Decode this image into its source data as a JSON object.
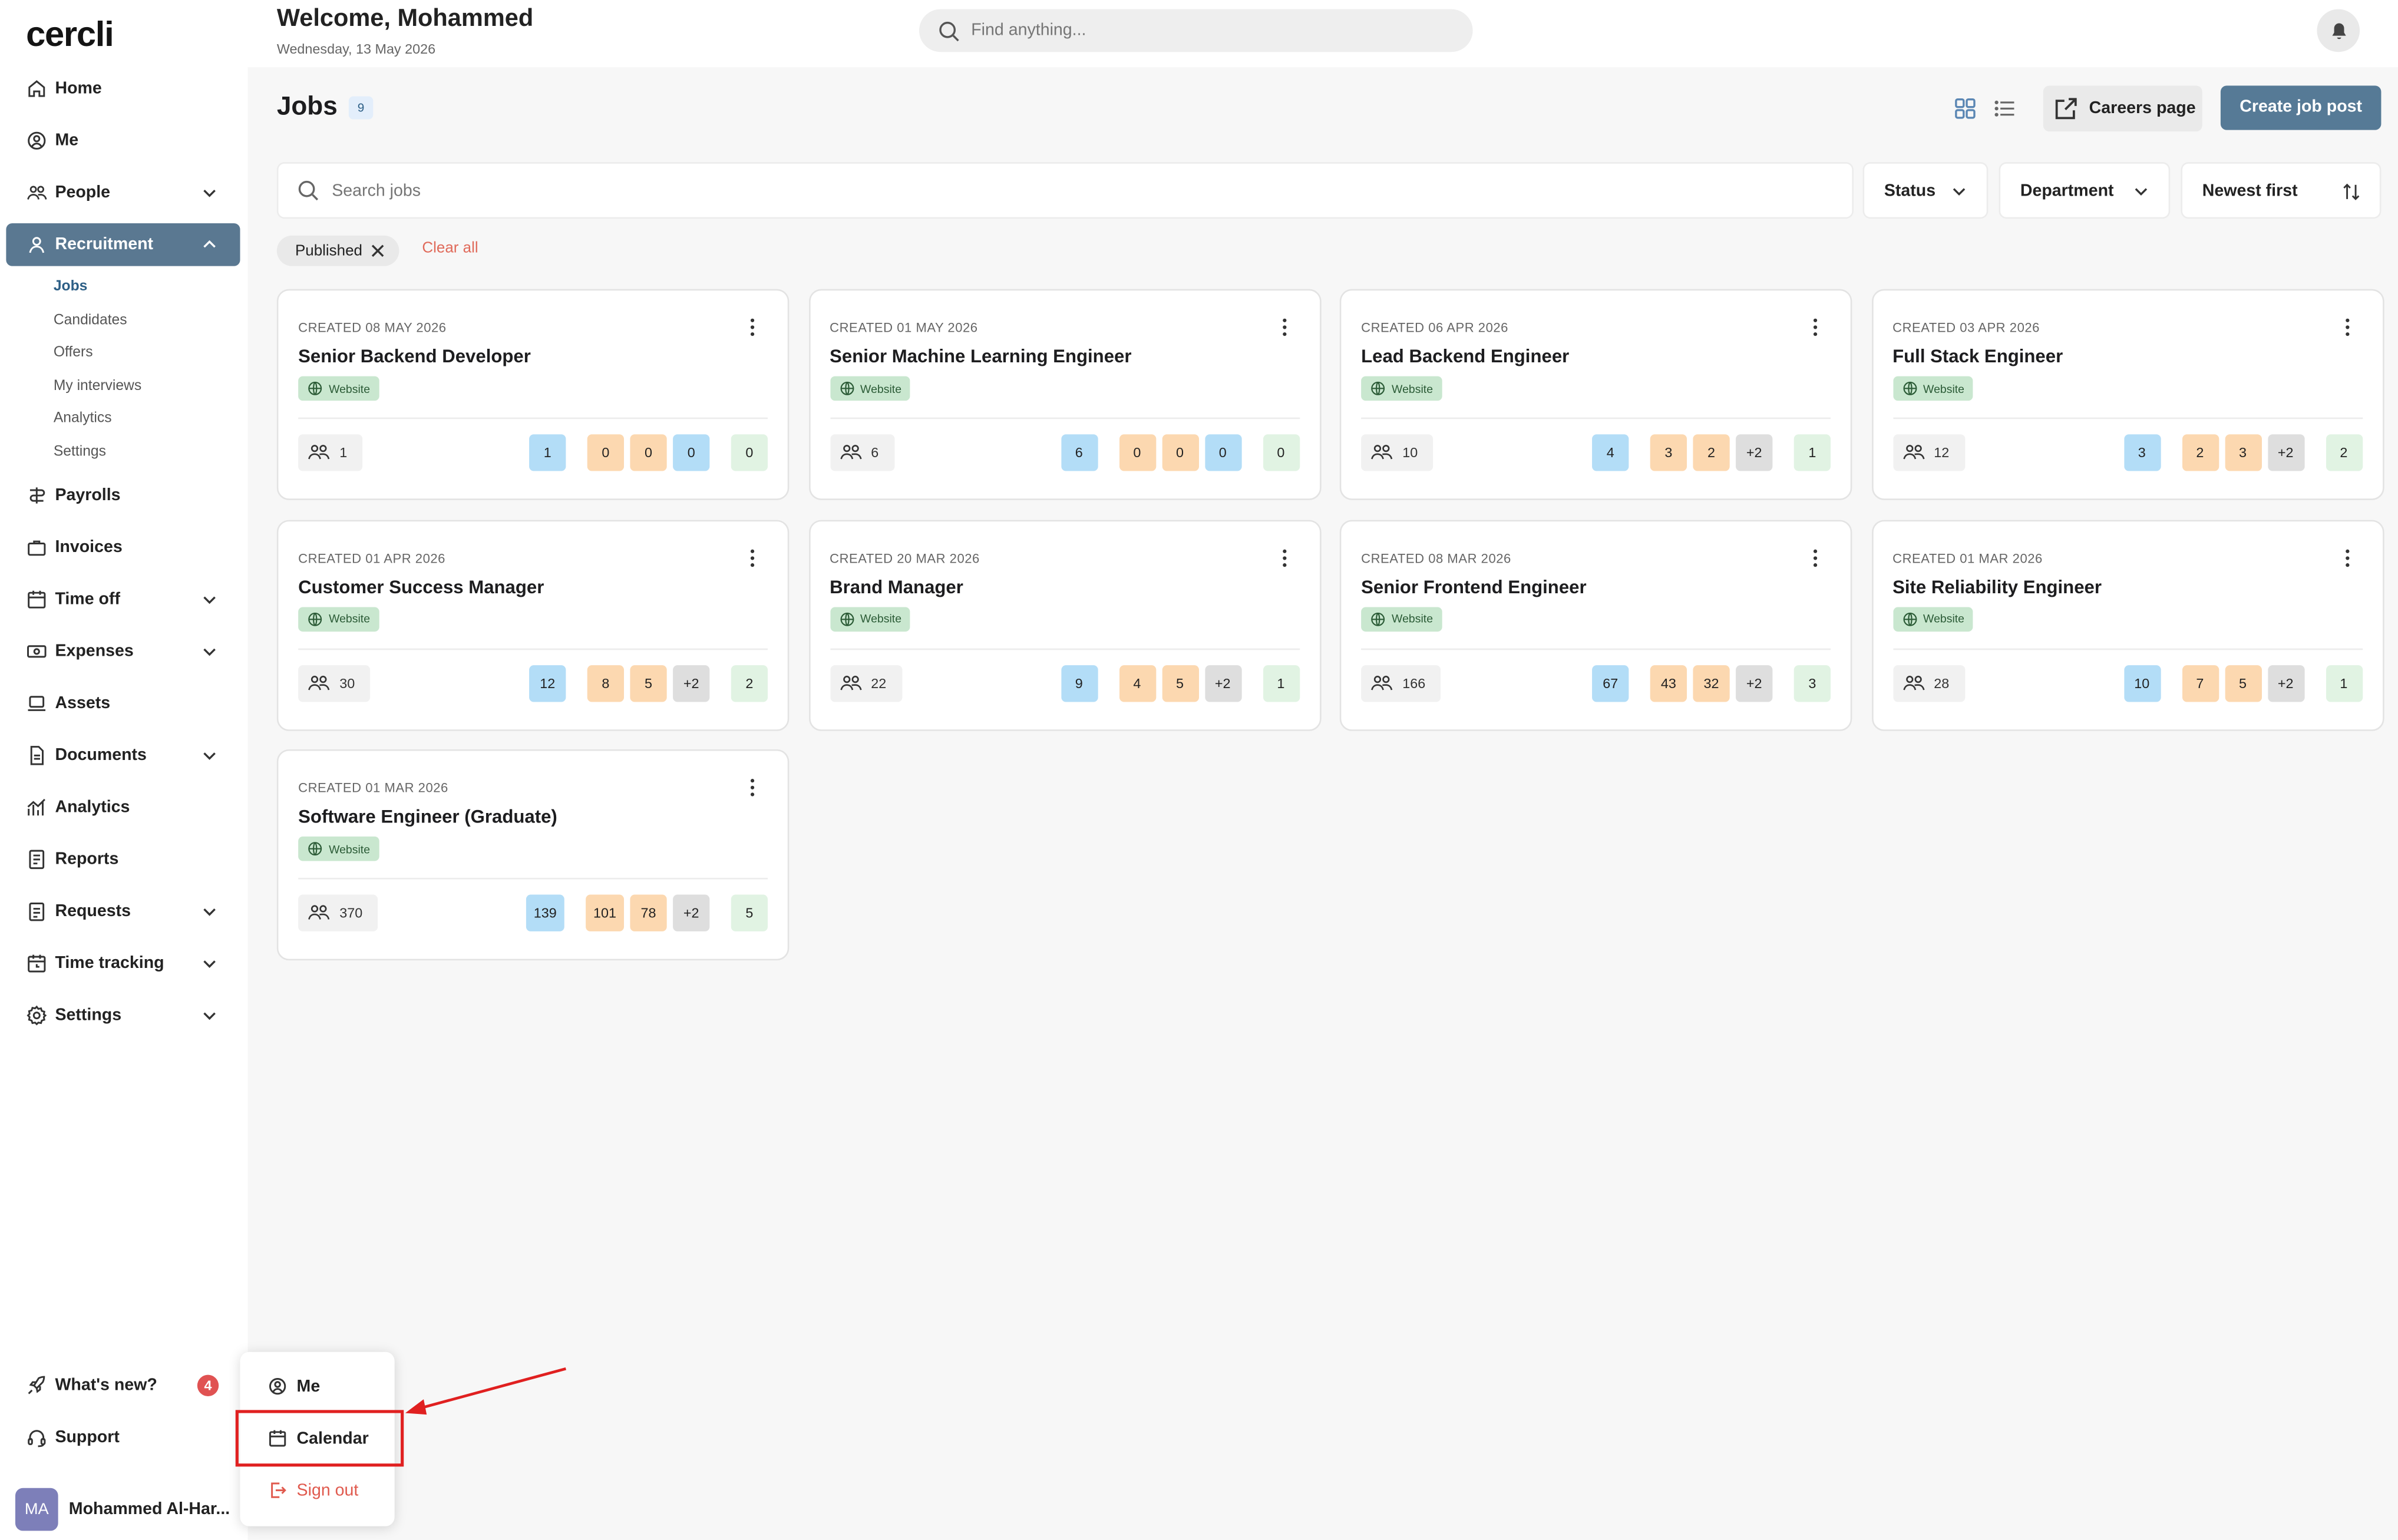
{
  "app": {
    "logo": "cercli"
  },
  "header": {
    "welcome": "Welcome, Mohammed",
    "date": "Wednesday, 13 May 2026",
    "search_placeholder": "Find anything...",
    "bell_icon": "bell-icon"
  },
  "sidebar": {
    "items": [
      {
        "label": "Home",
        "icon": "home-icon"
      },
      {
        "label": "Me",
        "icon": "user-circle-icon"
      },
      {
        "label": "People",
        "icon": "people-icon"
      },
      {
        "label": "Recruitment",
        "icon": "user-icon"
      },
      {
        "label": "Payrolls",
        "icon": "payroll-icon"
      },
      {
        "label": "Invoices",
        "icon": "briefcase-icon"
      },
      {
        "label": "Time off",
        "icon": "calendar-icon"
      },
      {
        "label": "Expenses",
        "icon": "cash-icon"
      },
      {
        "label": "Assets",
        "icon": "laptop-icon"
      },
      {
        "label": "Documents",
        "icon": "document-icon"
      },
      {
        "label": "Analytics",
        "icon": "chart-icon"
      },
      {
        "label": "Reports",
        "icon": "report-icon"
      },
      {
        "label": "Requests",
        "icon": "request-icon"
      },
      {
        "label": "Time tracking",
        "icon": "clock-calendar-icon"
      },
      {
        "label": "Settings",
        "icon": "gear-icon"
      }
    ],
    "recruitment_sub": [
      "Jobs",
      "Candidates",
      "Offers",
      "My interviews",
      "Analytics",
      "Settings"
    ],
    "bottom": {
      "whats_new": "What's new?",
      "whats_new_count": "4",
      "support": "Support"
    },
    "user": {
      "initials": "MA",
      "name": "Mohammed Al-Har..."
    }
  },
  "page": {
    "title": "Jobs",
    "count": "9",
    "careers_label": "Careers page",
    "create_label": "Create job post",
    "search_placeholder": "Search jobs",
    "filters": {
      "status": "Status",
      "department": "Department",
      "sort": "Newest first"
    },
    "chip": "Published",
    "clear_all": "Clear all"
  },
  "jobs": [
    {
      "created": "CREATED 08 MAY 2026",
      "title": "Senior Backend Developer",
      "source": "Website",
      "candidates": "1",
      "stats": [
        "1",
        "0",
        "0",
        "0",
        "0"
      ]
    },
    {
      "created": "CREATED 01 MAY 2026",
      "title": "Senior Machine Learning Engineer",
      "source": "Website",
      "candidates": "6",
      "stats": [
        "6",
        "0",
        "0",
        "0",
        "0"
      ]
    },
    {
      "created": "CREATED 06 APR 2026",
      "title": "Lead Backend Engineer",
      "source": "Website",
      "candidates": "10",
      "stats": [
        "4",
        "3",
        "2",
        "+2",
        "1"
      ]
    },
    {
      "created": "CREATED 03 APR 2026",
      "title": "Full Stack Engineer",
      "source": "Website",
      "candidates": "12",
      "stats": [
        "3",
        "2",
        "3",
        "+2",
        "2"
      ]
    },
    {
      "created": "CREATED 01 APR 2026",
      "title": "Customer Success Manager",
      "source": "Website",
      "candidates": "30",
      "stats": [
        "12",
        "8",
        "5",
        "+2",
        "2"
      ]
    },
    {
      "created": "CREATED 20 MAR 2026",
      "title": "Brand Manager",
      "source": "Website",
      "candidates": "22",
      "stats": [
        "9",
        "4",
        "5",
        "+2",
        "1"
      ]
    },
    {
      "created": "CREATED 08 MAR 2026",
      "title": "Senior Frontend Engineer",
      "source": "Website",
      "candidates": "166",
      "stats": [
        "67",
        "43",
        "32",
        "+2",
        "3"
      ]
    },
    {
      "created": "CREATED 01 MAR 2026",
      "title": "Site Reliability Engineer",
      "source": "Website",
      "candidates": "28",
      "stats": [
        "10",
        "7",
        "5",
        "+2",
        "1"
      ]
    },
    {
      "created": "CREATED 01 MAR 2026",
      "title": "Software Engineer (Graduate)",
      "source": "Website",
      "candidates": "370",
      "stats": [
        "139",
        "101",
        "78",
        "+2",
        "5"
      ]
    }
  ],
  "user_menu": {
    "me": "Me",
    "calendar": "Calendar",
    "sign_out": "Sign out"
  },
  "colors": {
    "accent": "#567a96",
    "active_nav": "#5a7891",
    "highlight": "#e02020",
    "danger": "#e05a4e"
  }
}
